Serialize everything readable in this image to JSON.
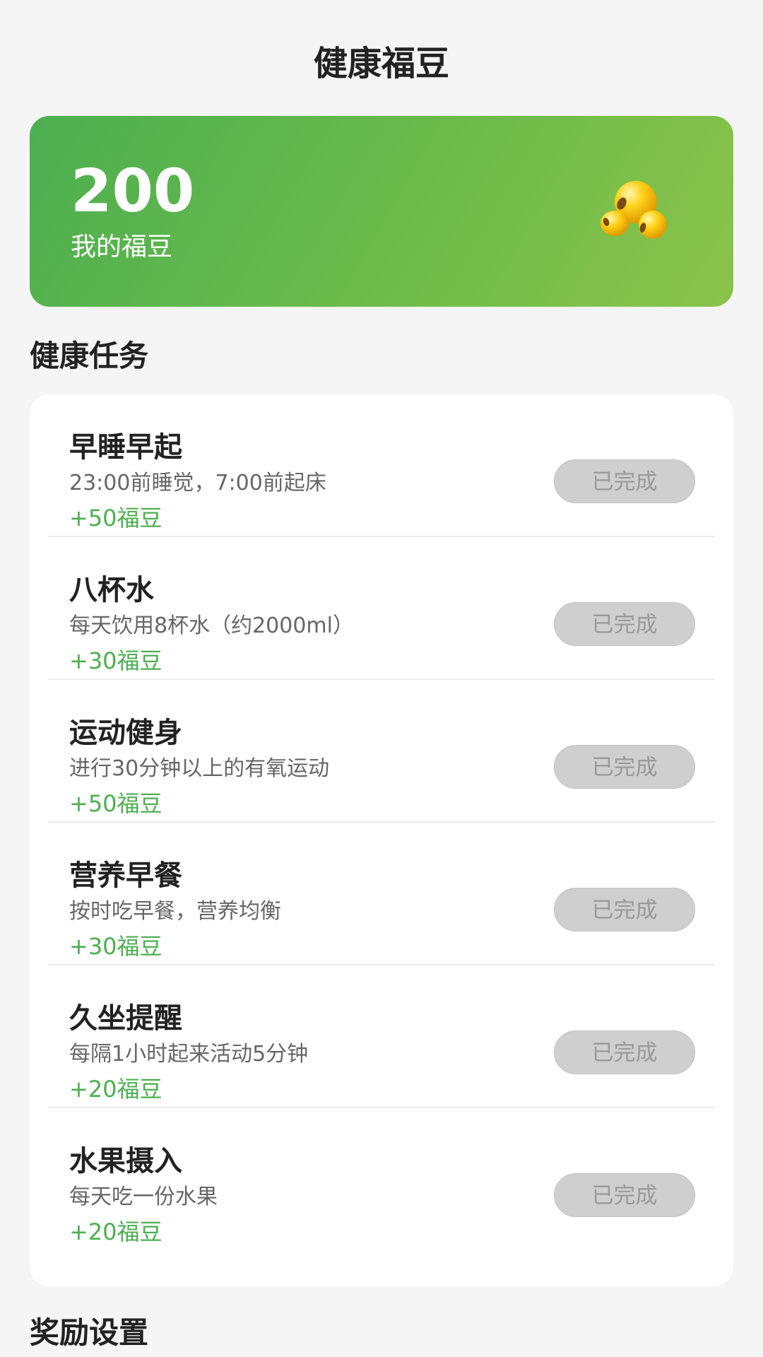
{
  "header": {
    "title": "健康福豆"
  },
  "balance": {
    "value": "200",
    "label": "我的福豆"
  },
  "tasks_section": {
    "title": "健康任务"
  },
  "tasks": [
    {
      "name": "早睡早起",
      "desc": "23:00前睡觉，7:00前起床",
      "reward": "+50福豆",
      "status": "已完成"
    },
    {
      "name": "八杯水",
      "desc": "每天饮用8杯水（约2000ml）",
      "reward": "+30福豆",
      "status": "已完成"
    },
    {
      "name": "运动健身",
      "desc": "进行30分钟以上的有氧运动",
      "reward": "+50福豆",
      "status": "已完成"
    },
    {
      "name": "营养早餐",
      "desc": "按时吃早餐，营养均衡",
      "reward": "+30福豆",
      "status": "已完成"
    },
    {
      "name": "久坐提醒",
      "desc": "每隔1小时起来活动5分钟",
      "reward": "+20福豆",
      "status": "已完成"
    },
    {
      "name": "水果摄入",
      "desc": "每天吃一份水果",
      "reward": "+20福豆",
      "status": "已完成"
    }
  ],
  "rewards_section": {
    "title": "奖励设置"
  },
  "colors": {
    "accent": "#4caf50",
    "card_gradient_end": "#8bc34a",
    "disabled": "#cfcfcf"
  },
  "icons": {
    "balance": "golden-beans-icon"
  }
}
